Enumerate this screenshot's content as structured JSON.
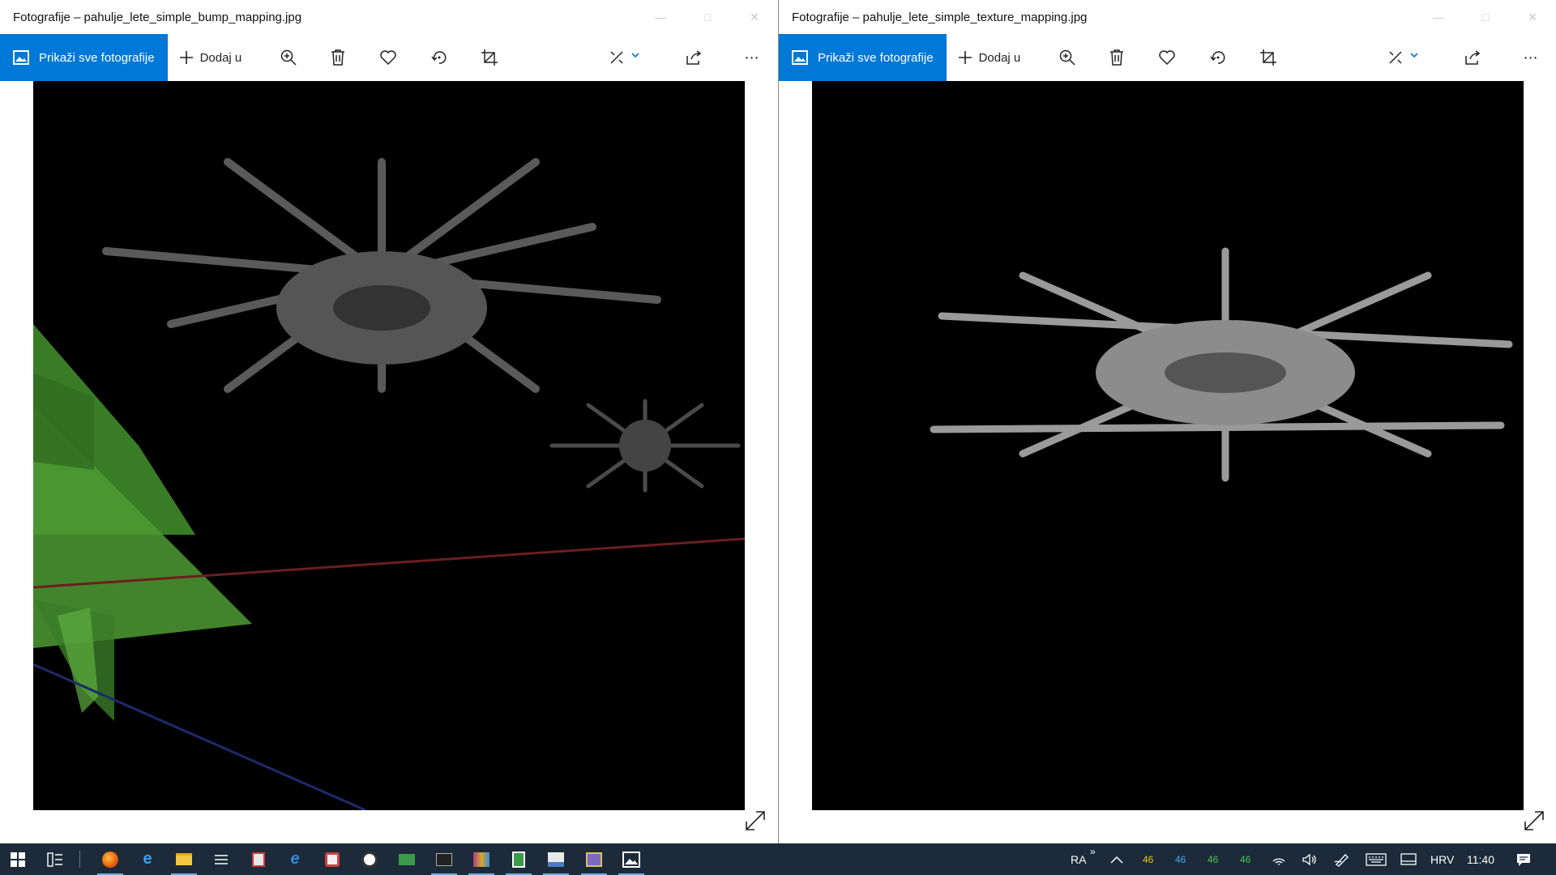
{
  "windows": [
    {
      "title": "Fotografije – pahulje_lete_simple_bump_mapping.jpg",
      "toolbar": {
        "show_all_label": "Prikaži sve fotografije",
        "add_label": "Dodaj u"
      }
    },
    {
      "title": "Fotografije – pahulje_lete_simple_texture_mapping.jpg",
      "toolbar": {
        "show_all_label": "Prikaži sve fotografije",
        "add_label": "Dodaj u"
      }
    }
  ],
  "icons": {
    "toolbar": [
      "zoom-icon",
      "delete-icon",
      "favorite-icon",
      "rotate-icon",
      "crop-icon",
      "edit-icon",
      "share-icon",
      "more-icon"
    ],
    "taskbar": [
      "start-icon",
      "task-view-icon",
      "firefox-icon",
      "edge-icon",
      "file-explorer-icon",
      "settings-icon",
      "app-icon",
      "internet-explorer-icon",
      "app-icon",
      "app-icon",
      "app-icon",
      "terminal-icon",
      "app-icon",
      "app-icon",
      "app-icon",
      "app-icon",
      "photos-icon"
    ]
  },
  "taskbar": {
    "tray_label": "RA",
    "temps": [
      {
        "value": "46",
        "color": "#f0c419"
      },
      {
        "value": "46",
        "color": "#3fa9f5"
      },
      {
        "value": "46",
        "color": "#46c84a"
      },
      {
        "value": "46",
        "color": "#46c84a"
      }
    ],
    "language": "HRV",
    "time": "11:40"
  },
  "colors": {
    "accent": "#0078d7",
    "taskbar_bg": "#1c2a39",
    "photo_bg": "#000000"
  }
}
